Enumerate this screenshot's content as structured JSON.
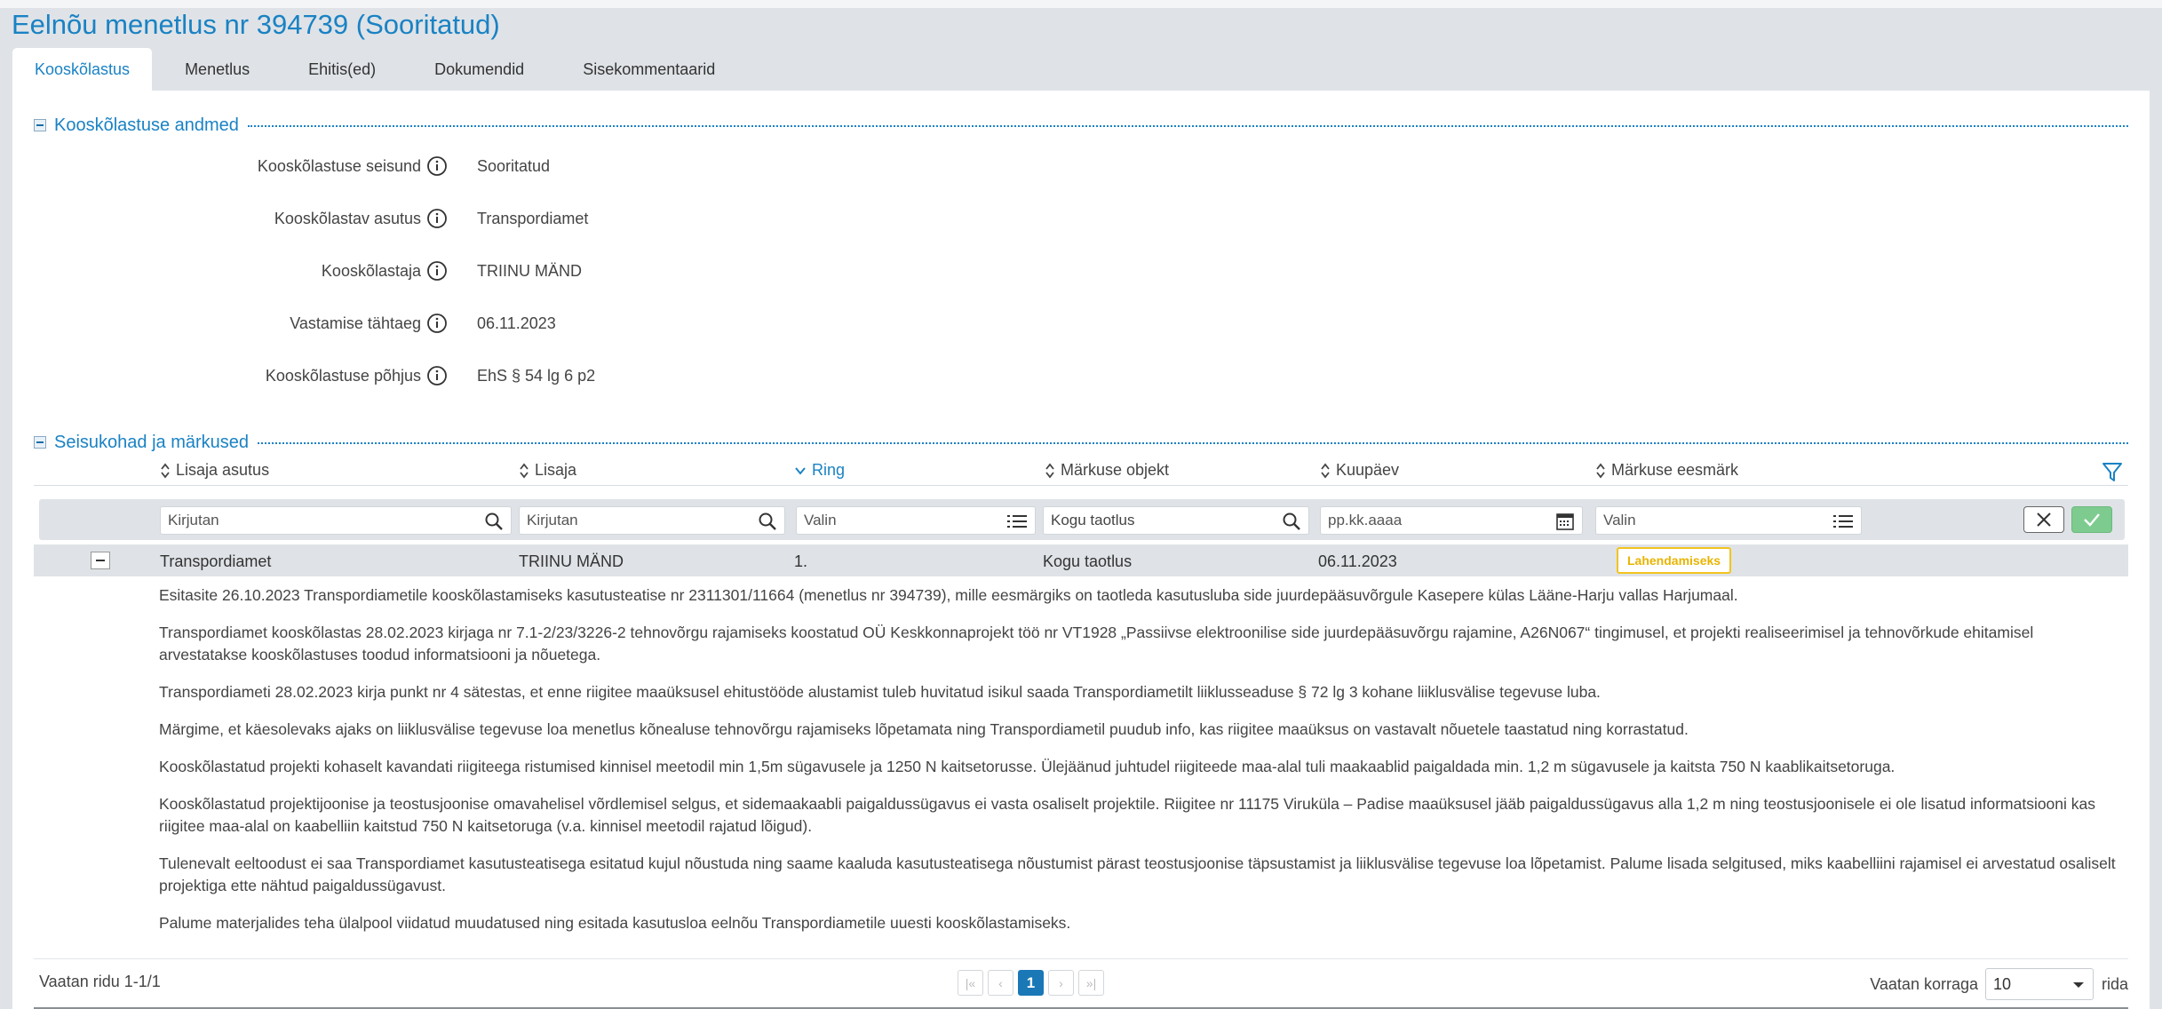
{
  "page": {
    "title": "Eelnõu menetlus nr 394739 (Sooritatud)"
  },
  "tabs": [
    {
      "label": "Kooskõlastus",
      "active": true
    },
    {
      "label": "Menetlus"
    },
    {
      "label": "Ehitis(ed)"
    },
    {
      "label": "Dokumendid"
    },
    {
      "label": "Sisekommentaarid"
    }
  ],
  "section1": {
    "title": "Kooskõlastuse andmed",
    "fields": [
      {
        "label": "Kooskõlastuse seisund",
        "value": "Sooritatud"
      },
      {
        "label": "Kooskõlastav asutus",
        "value": "Transpordiamet"
      },
      {
        "label": "Kooskõlastaja",
        "value": "TRIINU MÄND"
      },
      {
        "label": "Vastamise tähtaeg",
        "value": "06.11.2023"
      },
      {
        "label": "Kooskõlastuse põhjus",
        "value": "EhS § 54 lg 6 p2"
      }
    ]
  },
  "section2": {
    "title": "Seisukohad ja märkused",
    "columns": [
      "Lisaja asutus",
      "Lisaja",
      "Ring",
      "Märkuse objekt",
      "Kuupäev",
      "Märkuse eesmärk"
    ],
    "filters": {
      "col1": "Kirjutan",
      "col2": "Kirjutan",
      "col3": "Valin",
      "col4": "Kogu taotlus",
      "col5": "pp.kk.aaaa",
      "col6": "Valin"
    },
    "row": {
      "asutus": "Transpordiamet",
      "lisaja": "TRIINU MÄND",
      "ring": "1.",
      "objekt": "Kogu taotlus",
      "kuupaev": "06.11.2023",
      "eesmark": "Lahendamiseks"
    },
    "comments": [
      "Esitasite 26.10.2023 Transpordiametile kooskõlastamiseks kasutusteatise nr 2311301/11664 (menetlus nr 394739), mille eesmärgiks on taotleda kasutusluba side juurdepääsuvõrgule Kasepere külas Lääne-Harju vallas Harjumaal.",
      "Transpordiamet kooskõlastas 28.02.2023 kirjaga nr 7.1-2/23/3226-2 tehnovõrgu rajamiseks koostatud OÜ Keskkonnaprojekt töö nr VT1928 „Passiivse elektroonilise side juurdepääsuvõrgu rajamine, A26N067“ tingimusel, et  projekti realiseerimisel ja tehnovõrkude ehitamisel arvestatakse kooskõlastuses toodud informatsiooni ja nõuetega.",
      "Transpordiameti 28.02.2023 kirja punkt nr 4 sätestas, et enne riigitee maaüksusel ehitustööde alustamist tuleb huvitatud isikul saada Transpordiametilt liiklusseaduse § 72 lg 3 kohane liiklusvälise tegevuse luba.",
      "Märgime, et käesolevaks ajaks on liiklusvälise tegevuse loa menetlus kõnealuse tehnovõrgu rajamiseks lõpetamata ning Transpordiametil puudub info, kas riigitee maaüksus on vastavalt nõuetele taastatud ning korrastatud.",
      "Kooskõlastatud projekti kohaselt kavandati riigiteega ristumised kinnisel meetodil min 1,5m sügavusele ja 1250 N kaitsetorusse. Ülejäänud juhtudel riigiteede maa-alal tuli maakaablid paigaldada min. 1,2 m sügavusele ja kaitsta 750 N kaablikaitsetoruga.",
      "Kooskõlastatud projektijoonise ja teostusjoonise omavahelisel võrdlemisel selgus, et sidemaakaabli paigaldussügavus ei vasta osaliselt projektile. Riigitee nr 11175 Virukülа – Padise maaüksusel jääb paigaldussügavus alla 1,2 m ning teostusjoonisele ei ole lisatud informatsiooni kas riigitee maa-alal on kaabelliin kaitstud 750 N kaitsetoruga (v.a. kinnisel meetodil rajatud lõigud).",
      "Tulenevalt eeltoodust ei saa Transpordiamet kasutusteatisega esitatud kujul nõustuda ning saame kaaluda kasutusteatisega nõustumist pärast teostusjoonise täpsustamist ja liiklusvälise tegevuse loa lõpetamist. Palume lisada selgitused, miks kaabelliini rajamisel ei arvestatud osaliselt projektiga ette nähtud paigaldussügavust.",
      "Palume materjalides teha ülalpool viidatud muudatused ning esitada kasutusloa eelnõu Transpordiametile uuesti kooskõlastamiseks."
    ]
  },
  "pager": {
    "rows_info": "Vaatan ridu 1-1/1",
    "current_page": "1",
    "first": "|«",
    "prev": "‹",
    "next": "›",
    "last": "»|",
    "per_page_label": "Vaatan korraga",
    "per_page_value": "10",
    "per_page_suffix": "rida"
  }
}
